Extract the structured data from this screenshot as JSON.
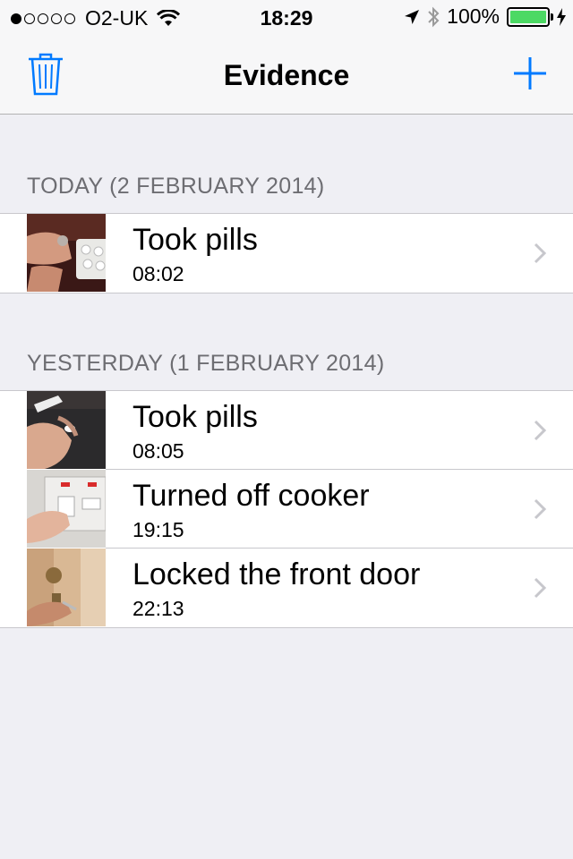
{
  "status_bar": {
    "carrier": "O2-UK",
    "time": "18:29",
    "battery": "100%",
    "signal_bars_filled": 1,
    "signal_bars_total": 5
  },
  "nav": {
    "title": "Evidence",
    "left_icon": "trash-icon",
    "right_icon": "plus-icon"
  },
  "colors": {
    "accent": "#007aff",
    "battery_fill": "#4cd964",
    "background": "#efeff4"
  },
  "sections": [
    {
      "header": "TODAY (2 FEBRUARY 2014)",
      "items": [
        {
          "title": "Took pills",
          "time": "08:02"
        }
      ]
    },
    {
      "header": "YESTERDAY (1 FEBRUARY 2014)",
      "items": [
        {
          "title": "Took pills",
          "time": "08:05"
        },
        {
          "title": "Turned off cooker",
          "time": "19:15"
        },
        {
          "title": "Locked the front door",
          "time": "22:13"
        }
      ]
    }
  ]
}
